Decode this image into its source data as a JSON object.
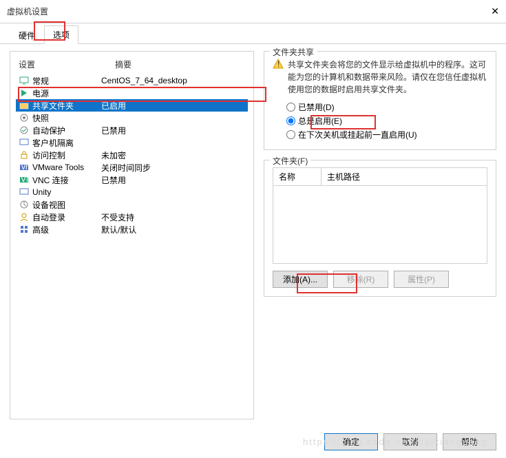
{
  "titlebar": {
    "title": "虚拟机设置"
  },
  "tabs": {
    "hardware": "硬件",
    "options": "选项"
  },
  "left": {
    "col_setting": "设置",
    "col_summary": "摘要",
    "rows": [
      {
        "label": "常规",
        "summary": "CentOS_7_64_desktop"
      },
      {
        "label": "电源",
        "summary": ""
      },
      {
        "label": "共享文件夹",
        "summary": "已启用"
      },
      {
        "label": "快照",
        "summary": ""
      },
      {
        "label": "自动保护",
        "summary": "已禁用"
      },
      {
        "label": "客户机隔离",
        "summary": ""
      },
      {
        "label": "访问控制",
        "summary": "未加密"
      },
      {
        "label": "VMware Tools",
        "summary": "关闭时间同步"
      },
      {
        "label": "VNC 连接",
        "summary": "已禁用"
      },
      {
        "label": "Unity",
        "summary": ""
      },
      {
        "label": "设备视图",
        "summary": ""
      },
      {
        "label": "自动登录",
        "summary": "不受支持"
      },
      {
        "label": "高级",
        "summary": "默认/默认"
      }
    ]
  },
  "right": {
    "share_legend": "文件夹共享",
    "warning": "共享文件夹会将您的文件显示给虚拟机中的程序。这可能为您的计算机和数据带来风险。请仅在您信任虚拟机使用您的数据时启用共享文件夹。",
    "radio_disabled": "已禁用(D)",
    "radio_always": "总是启用(E)",
    "radio_until": "在下次关机或挂起前一直启用(U)",
    "folders_legend": "文件夹(F)",
    "col_name": "名称",
    "col_path": "主机路径",
    "btn_add": "添加(A)...",
    "btn_remove": "移除(R)",
    "btn_props": "属性(P)"
  },
  "footer": {
    "ok": "确定",
    "cancel": "取消",
    "help": "帮助"
  },
  "watermark": "https://blog.csdn.net/maixiaoguang"
}
